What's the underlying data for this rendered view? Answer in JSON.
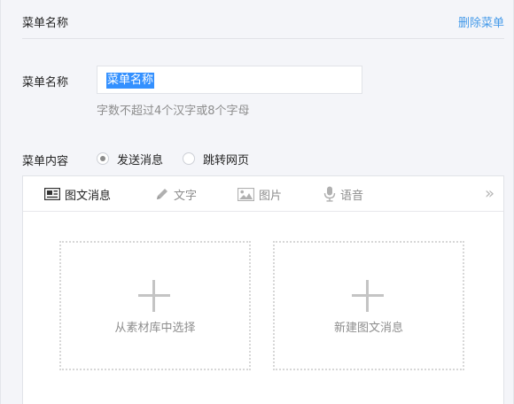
{
  "header": {
    "title": "菜单名称",
    "delete_link": "删除菜单"
  },
  "form": {
    "name_label": "菜单名称",
    "name_value": "菜单名称",
    "name_hint": "字数不超过4个汉字或8个字母",
    "content_label": "菜单内容",
    "content_options": [
      {
        "label": "发送消息",
        "selected": true
      },
      {
        "label": "跳转网页",
        "selected": false
      }
    ]
  },
  "editor": {
    "tabs": [
      {
        "label": "图文消息",
        "icon": "news-icon",
        "active": true
      },
      {
        "label": "文字",
        "icon": "pencil-icon",
        "active": false
      },
      {
        "label": "图片",
        "icon": "image-icon",
        "active": false
      },
      {
        "label": "语音",
        "icon": "microphone-icon",
        "active": false
      }
    ],
    "more_icon": "double-chevron-right-icon",
    "cards": [
      {
        "label": "从素材库中选择",
        "icon": "plus-icon"
      },
      {
        "label": "新建图文消息",
        "icon": "plus-icon"
      }
    ]
  },
  "colors": {
    "link": "#459ae9",
    "selection": "#3390ff",
    "background": "#f4f5f9",
    "muted_text": "#8d8d8d"
  }
}
